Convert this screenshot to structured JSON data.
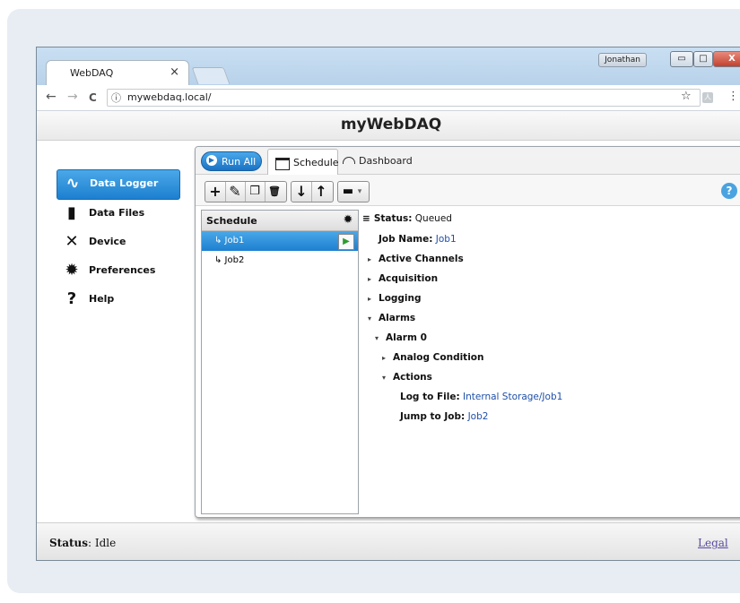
{
  "browser": {
    "tab_title": "WebDAQ",
    "tab_close": "×",
    "user": "Jonathan",
    "window_buttons": {
      "minimize": "▭",
      "maximize": "□",
      "close": "X"
    },
    "nav": {
      "back": "←",
      "forward": "→",
      "reload": "C"
    },
    "url_info_icon": "ⓘ",
    "url": "mywebdaq.local/",
    "bookmark_icon": "☆",
    "ext_icon": "人",
    "menu_icon": "⋮"
  },
  "app": {
    "title": "myWebDAQ"
  },
  "sidebar": {
    "items": [
      {
        "label": "Data Logger",
        "icon": "pulse-icon",
        "glyph": "∿"
      },
      {
        "label": "Data Files",
        "icon": "files-icon",
        "glyph": "▮"
      },
      {
        "label": "Device",
        "icon": "tools-icon",
        "glyph": "✕"
      },
      {
        "label": "Preferences",
        "icon": "gear-icon",
        "glyph": "✹"
      },
      {
        "label": "Help",
        "icon": "question-icon",
        "glyph": "?"
      }
    ]
  },
  "panel": {
    "run_all": "Run All",
    "tabs": {
      "schedule": "Schedule",
      "dashboard": "Dashboard"
    },
    "toolbar": {
      "add": "+",
      "edit": "✎",
      "copy": "❐",
      "delete": "🗑",
      "down": "↓",
      "up": "↑",
      "folder": "▬",
      "folder_caret": "▾",
      "help": "?"
    }
  },
  "schedule": {
    "header": "Schedule",
    "header_icon": "✹",
    "jobs": [
      {
        "name": "↳ Job1",
        "selected": true
      },
      {
        "name": "↳ Job2",
        "selected": false
      }
    ],
    "play_icon": "▶"
  },
  "details": {
    "status_label": "Status:",
    "status_value": "Queued",
    "job_name_label": "Job Name:",
    "job_name_value": "Job1",
    "active_channels": "Active Channels",
    "acquisition": "Acquisition",
    "logging": "Logging",
    "alarms": "Alarms",
    "alarm0": "Alarm 0",
    "analog_condition": "Analog Condition",
    "actions": "Actions",
    "log_to_file_label": "Log to File:",
    "log_to_file_value": "Internal Storage/Job1",
    "jump_to_job_label": "Jump to Job:",
    "jump_to_job_value": "Job2",
    "collapsed_icon": "▸",
    "expanded_icon": "▾",
    "status_icon": "≡"
  },
  "statusbar": {
    "label": "Status",
    "value": ": Idle",
    "legal": "Legal"
  },
  "colors": {
    "accent": "#1d7fd0",
    "link": "#1f4fa8",
    "play": "#2e9b2e"
  }
}
